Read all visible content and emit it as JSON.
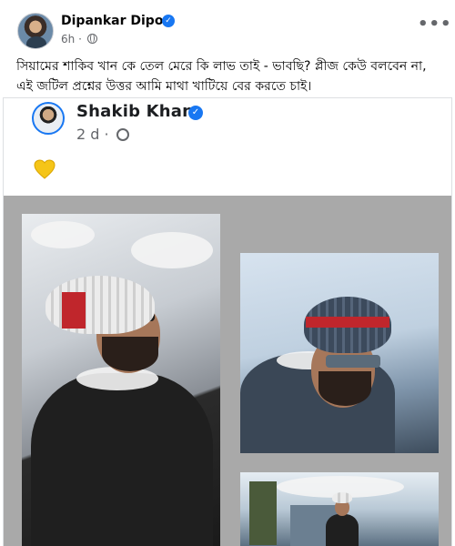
{
  "post": {
    "author": "Dipankar Dipon",
    "time": "6h",
    "dot": "·",
    "caption": "সিয়ামের শাকিব খান কে তেল মেরে কি লাভ তাই - ভাবছি? প্লীজ কেউ বলবেন না, এই জটিল প্রশ্নের উত্তর আমি মাথা খাটিয়ে বের করতে চাই।"
  },
  "shared": {
    "author": "Shakib Khan",
    "time": "2 d",
    "dot": "·",
    "content_emoji": "yellow-heart-icon"
  },
  "icons": {
    "verified": "✓",
    "more": "•••",
    "globe": "globe-icon"
  },
  "colors": {
    "brand_blue": "#1877f2",
    "secondary_text": "#65676b",
    "photo_background": "#a9a9a9",
    "heart_yellow": "#f5c518"
  }
}
